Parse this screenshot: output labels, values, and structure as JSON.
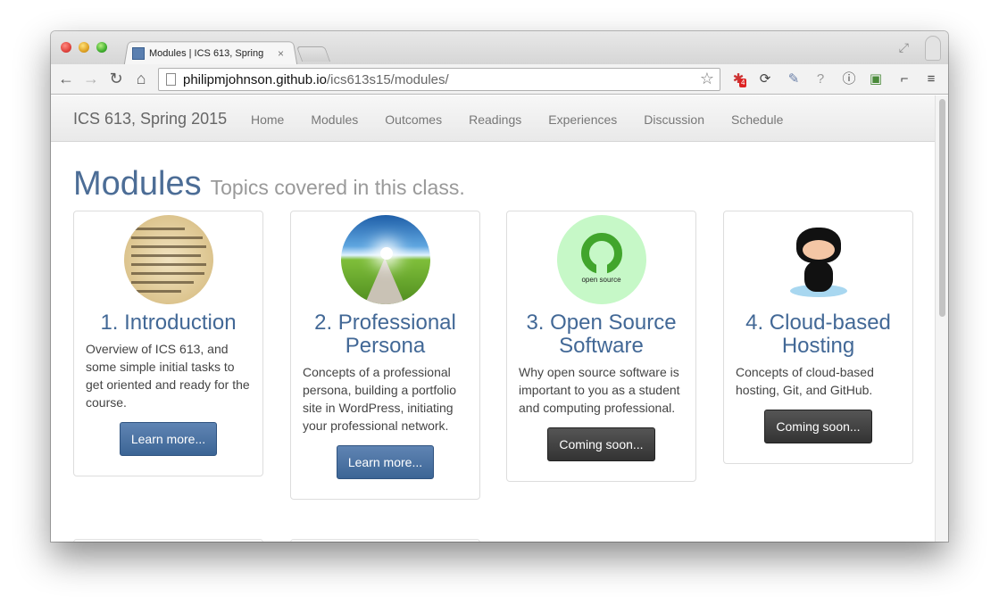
{
  "browser": {
    "tab_title": "Modules | ICS 613, Spring",
    "tab_close": "×",
    "url_host": "philipmjohnson.github.io",
    "url_path": "/ics613s15/modules/",
    "ext_badge": "4"
  },
  "site": {
    "brand": "ICS 613, Spring 2015",
    "nav": [
      "Home",
      "Modules",
      "Outcomes",
      "Readings",
      "Experiences",
      "Discussion",
      "Schedule"
    ]
  },
  "page": {
    "title": "Modules",
    "subtitle": "Topics covered in this class."
  },
  "modules": [
    {
      "title": "1. Introduction",
      "description": "Overview of ICS 613, and some simple initial tasks to get oriented and ready for the course.",
      "button": "Learn more...",
      "image": "dictionary-introduction-image"
    },
    {
      "title": "2. Professional Persona",
      "description": "Concepts of a professional persona, building a portfolio site in WordPress, initiating your professional network.",
      "button": "Learn more...",
      "image": "road-to-horizon-image"
    },
    {
      "title": "3. Open Source Software",
      "description": "Why open source software is important to you as a student and computing professional.",
      "button": "Coming soon...",
      "image": "open-source-logo-image",
      "image_label": "open source"
    },
    {
      "title": "4. Cloud-based Hosting",
      "description": "Concepts of cloud-based hosting, Git, and GitHub.",
      "button": "Coming soon...",
      "image": "github-octocat-image"
    }
  ],
  "colors": {
    "heading": "#4c6d96",
    "primary_button": "#3c6595",
    "dark_button": "#333333"
  }
}
